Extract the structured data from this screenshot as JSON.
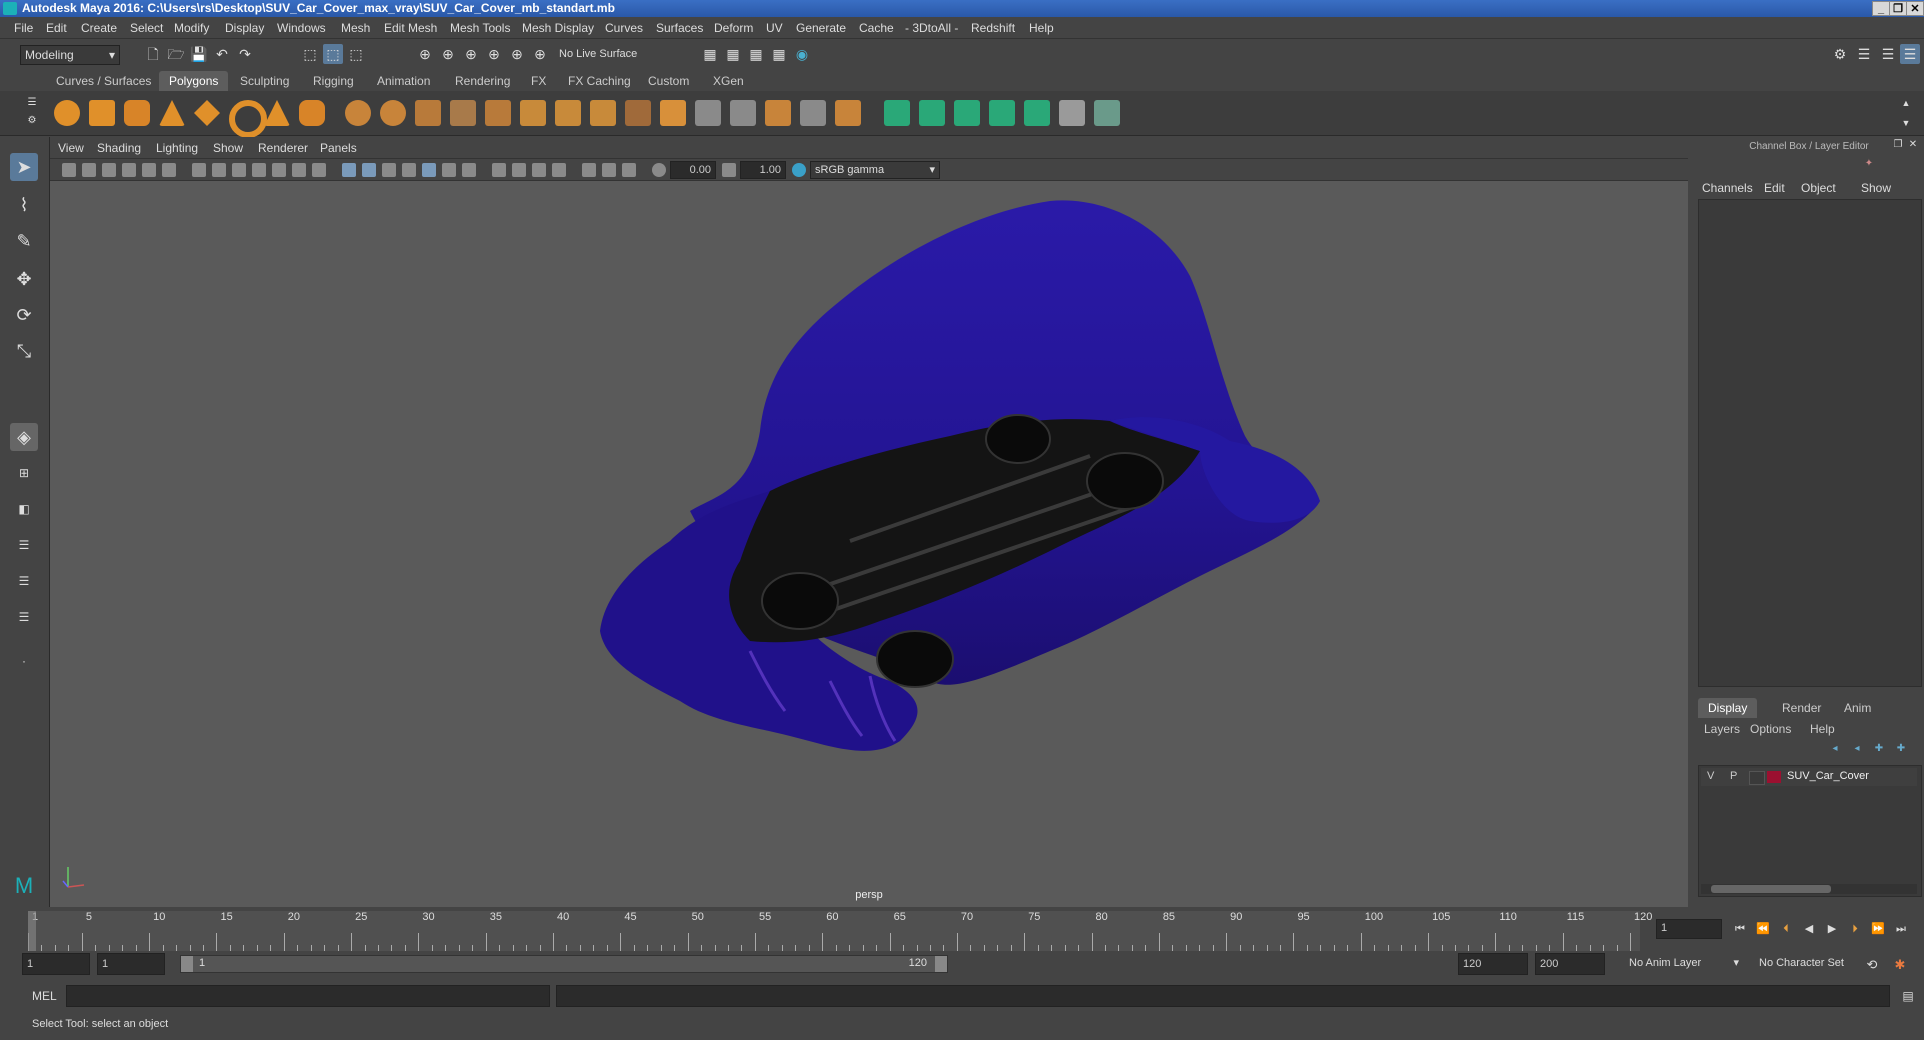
{
  "window": {
    "title": "Autodesk Maya 2016: C:\\Users\\rs\\Desktop\\SUV_Car_Cover_max_vray\\SUV_Car_Cover_mb_standart.mb"
  },
  "menubar": [
    "File",
    "Edit",
    "Create",
    "Select",
    "Modify",
    "Display",
    "Windows",
    "Mesh",
    "Edit Mesh",
    "Mesh Tools",
    "Mesh Display",
    "Curves",
    "Surfaces",
    "Deform",
    "UV",
    "Generate",
    "Cache",
    "- 3DtoAll -",
    "Redshift",
    "Help"
  ],
  "status": {
    "mode": "Modeling",
    "live_surface": "No Live Surface"
  },
  "shelf_tabs": [
    "Curves / Surfaces",
    "Polygons",
    "Sculpting",
    "Rigging",
    "Animation",
    "Rendering",
    "FX",
    "FX Caching",
    "Custom",
    "XGen"
  ],
  "shelf_active": "Polygons",
  "panel_menu": [
    "View",
    "Shading",
    "Lighting",
    "Show",
    "Renderer",
    "Panels"
  ],
  "panel_toolbar": {
    "exposure": "0.00",
    "gamma": "1.00",
    "color_space": "sRGB gamma"
  },
  "viewport": {
    "camera": "persp"
  },
  "channel_box": {
    "title": "Channel Box / Layer Editor",
    "menu": [
      "Channels",
      "Edit",
      "Object",
      "Show"
    ]
  },
  "layer_editor": {
    "tabs": [
      "Display",
      "Render",
      "Anim"
    ],
    "active_tab": "Display",
    "menu": [
      "Layers",
      "Options",
      "Help"
    ],
    "layers": [
      {
        "v": "V",
        "p": "P",
        "name": "SUV_Car_Cover",
        "color": "#9b1030"
      }
    ]
  },
  "timeline": {
    "ticks": [
      "1",
      "5",
      "10",
      "15",
      "20",
      "25",
      "30",
      "35",
      "40",
      "45",
      "50",
      "55",
      "60",
      "65",
      "70",
      "75",
      "80",
      "85",
      "90",
      "95",
      "100",
      "105",
      "110",
      "115",
      "120"
    ],
    "current_frame": "1"
  },
  "range": {
    "start": "1",
    "anim_start": "1",
    "slider_start": "1",
    "slider_end": "120",
    "end": "120",
    "anim_end": "200",
    "anim_layer": "No Anim Layer",
    "character_set": "No Character Set"
  },
  "command": {
    "language": "MEL"
  },
  "help_line": "Select Tool: select an object",
  "colors": {
    "cover": "#2a169a",
    "accent": "#5d5d5d"
  }
}
